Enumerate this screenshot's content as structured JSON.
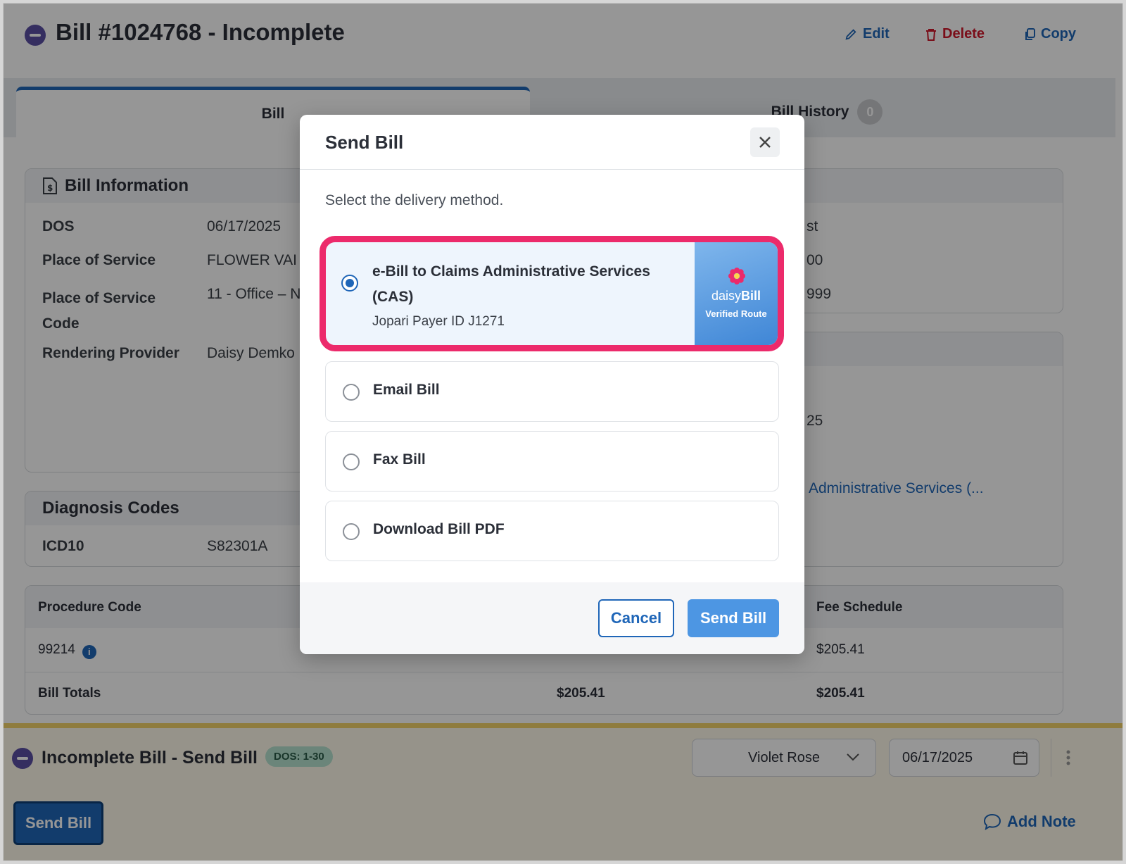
{
  "header": {
    "title": "Bill #1024768 - Incomplete",
    "edit_label": "Edit",
    "delete_label": "Delete",
    "copy_label": "Copy"
  },
  "tabs": [
    {
      "label": "Bill"
    },
    {
      "label": "Bill History",
      "count": "0"
    }
  ],
  "bill_information": {
    "title": "Bill Information",
    "fields": [
      {
        "label": "DOS",
        "value": "06/17/2025"
      },
      {
        "label": "Place of Service",
        "value": "FLOWER VAI"
      },
      {
        "label": "Place of Service Code",
        "value": "11 - Office – N"
      },
      {
        "label": "Rendering Provider",
        "value": "Daisy Demko"
      }
    ]
  },
  "right_peeks": {
    "p1": "st",
    "p2": "00",
    "p3": "999",
    "p4": "25",
    "link": "Administrative Services (..."
  },
  "diagnosis_codes": {
    "title": "Diagnosis Codes",
    "rows": [
      {
        "type": "ICD10",
        "code": "S82301A"
      }
    ]
  },
  "procedures": {
    "headers": {
      "code": "Procedure Code",
      "fee": "Fee Schedule"
    },
    "rows": [
      {
        "code": "99214",
        "fee": "$205.41"
      }
    ],
    "totals": {
      "label": "Bill Totals",
      "billed": "$205.41",
      "fee": "$205.41"
    }
  },
  "bottom_panel": {
    "title": "Incomplete Bill - Send Bill",
    "dos_badge": "DOS: 1-30",
    "assignee": "Violet Rose",
    "date": "06/17/2025",
    "send_label": "Send Bill",
    "add_note_label": "Add Note"
  },
  "modal": {
    "title": "Send Bill",
    "subtitle": "Select the delivery method.",
    "options": [
      {
        "label": "e-Bill to Claims Administrative Services (CAS)",
        "sub": "Jopari Payer ID J1271",
        "selected": true
      },
      {
        "label": "Email Bill",
        "selected": false
      },
      {
        "label": "Fax Bill",
        "selected": false
      },
      {
        "label": "Download Bill PDF",
        "selected": false
      }
    ],
    "verified": {
      "brand_light": "daisy",
      "brand_bold": "Bill",
      "route": "Verified Route"
    },
    "cancel_label": "Cancel",
    "send_label": "Send Bill"
  },
  "colors": {
    "accent": "#1f66b8",
    "danger": "#d0182c",
    "highlight": "#ec2a6b",
    "status": "#5b4ea3"
  }
}
